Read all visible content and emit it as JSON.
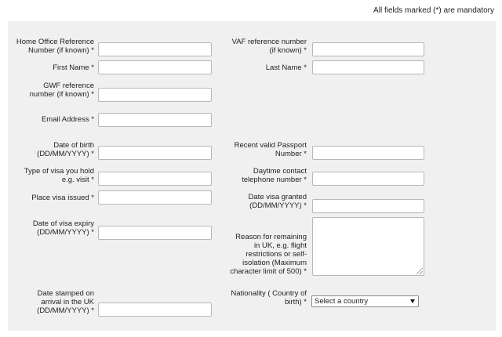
{
  "header": {
    "mandatory_note": "All fields marked (*) are mandatory"
  },
  "form": {
    "home_office_ref": {
      "label_lines": [
        "Home Office Reference",
        "Number (if known) *"
      ],
      "value": ""
    },
    "vaf_ref": {
      "label_lines": [
        "VAF reference number",
        "(if known) *"
      ],
      "value": ""
    },
    "first_name": {
      "label_lines": [
        "First Name *"
      ],
      "value": ""
    },
    "last_name": {
      "label_lines": [
        "Last Name *"
      ],
      "value": ""
    },
    "gwf_ref": {
      "label_lines": [
        "GWF reference",
        "number (if known) *"
      ],
      "value": ""
    },
    "email": {
      "label_lines": [
        "Email Address *"
      ],
      "value": ""
    },
    "dob": {
      "label_lines": [
        "Date of birth",
        "(DD/MM/YYYY) *"
      ],
      "value": ""
    },
    "passport": {
      "label_lines": [
        "Recent valid Passport",
        "Number *"
      ],
      "value": ""
    },
    "visa_type": {
      "label_lines": [
        "Type of visa you hold",
        "e.g. visit *"
      ],
      "value": ""
    },
    "telephone": {
      "label_lines": [
        "Daytime contact",
        "telephone number *"
      ],
      "value": ""
    },
    "visa_place": {
      "label_lines": [
        "Place visa issued *"
      ],
      "value": ""
    },
    "visa_granted": {
      "label_lines": [
        "Date visa granted",
        "(DD/MM/YYYY) *"
      ],
      "value": ""
    },
    "visa_expiry": {
      "label_lines": [
        "Date of visa expiry",
        "(DD/MM/YYYY) *"
      ],
      "value": ""
    },
    "reason": {
      "label_lines": [
        "Reason for remaining",
        "in UK, e.g. flight",
        "restrictions or self-",
        "isolation (Maximum",
        "character limit of 500) *"
      ],
      "value": ""
    },
    "date_stamped": {
      "label_lines": [
        "Date stamped on",
        "arrival in the UK",
        "(DD/MM/YYYY) *"
      ],
      "value": ""
    },
    "nationality": {
      "label_lines": [
        "Nationality ( Country of",
        "birth) *"
      ],
      "selected": "Select a country"
    }
  }
}
